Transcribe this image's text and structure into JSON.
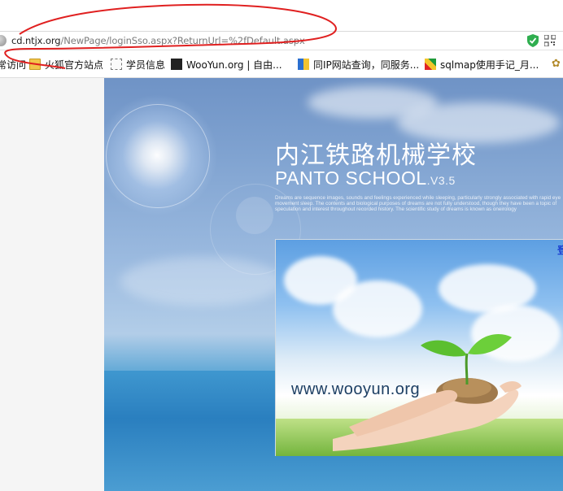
{
  "browser": {
    "url": {
      "host": "cd.ntjx.org",
      "path": "/NewPage/loginSso.aspx?ReturnUrl=%2fDefault.aspx"
    },
    "bookmarks": [
      {
        "label": "常访问",
        "icon": "none"
      },
      {
        "label": "火狐官方站点",
        "icon": "folder-icon"
      },
      {
        "label": "学员信息",
        "icon": "page-icon"
      },
      {
        "label": "WooYun.org | 自由...",
        "icon": "wooyun-icon"
      },
      {
        "label": "同IP网站查询，同服务...",
        "icon": "ip-lookup-icon"
      },
      {
        "label": "sqlmap使用手记_月...",
        "icon": "sqlmap-icon"
      }
    ]
  },
  "hero": {
    "school_name_cn": "内江铁路机械学校",
    "school_name_en": "PANTO SCHOOL",
    "version": ".V3.5",
    "description": "Dreams are sequence images, sounds and feelings experienced while sleeping, particularly strongly associated with rapid eye movement sleep. The contents and biological purposes of dreams are not fully understood, though they have been a topic of speculation and interest throughout recorded history. The scientific study of dreams is known as oneirology",
    "login_link": "登"
  },
  "watermark": "www.wooyun.org",
  "colors": {
    "annotation": "#e02020",
    "link": "#1a3dd1"
  }
}
